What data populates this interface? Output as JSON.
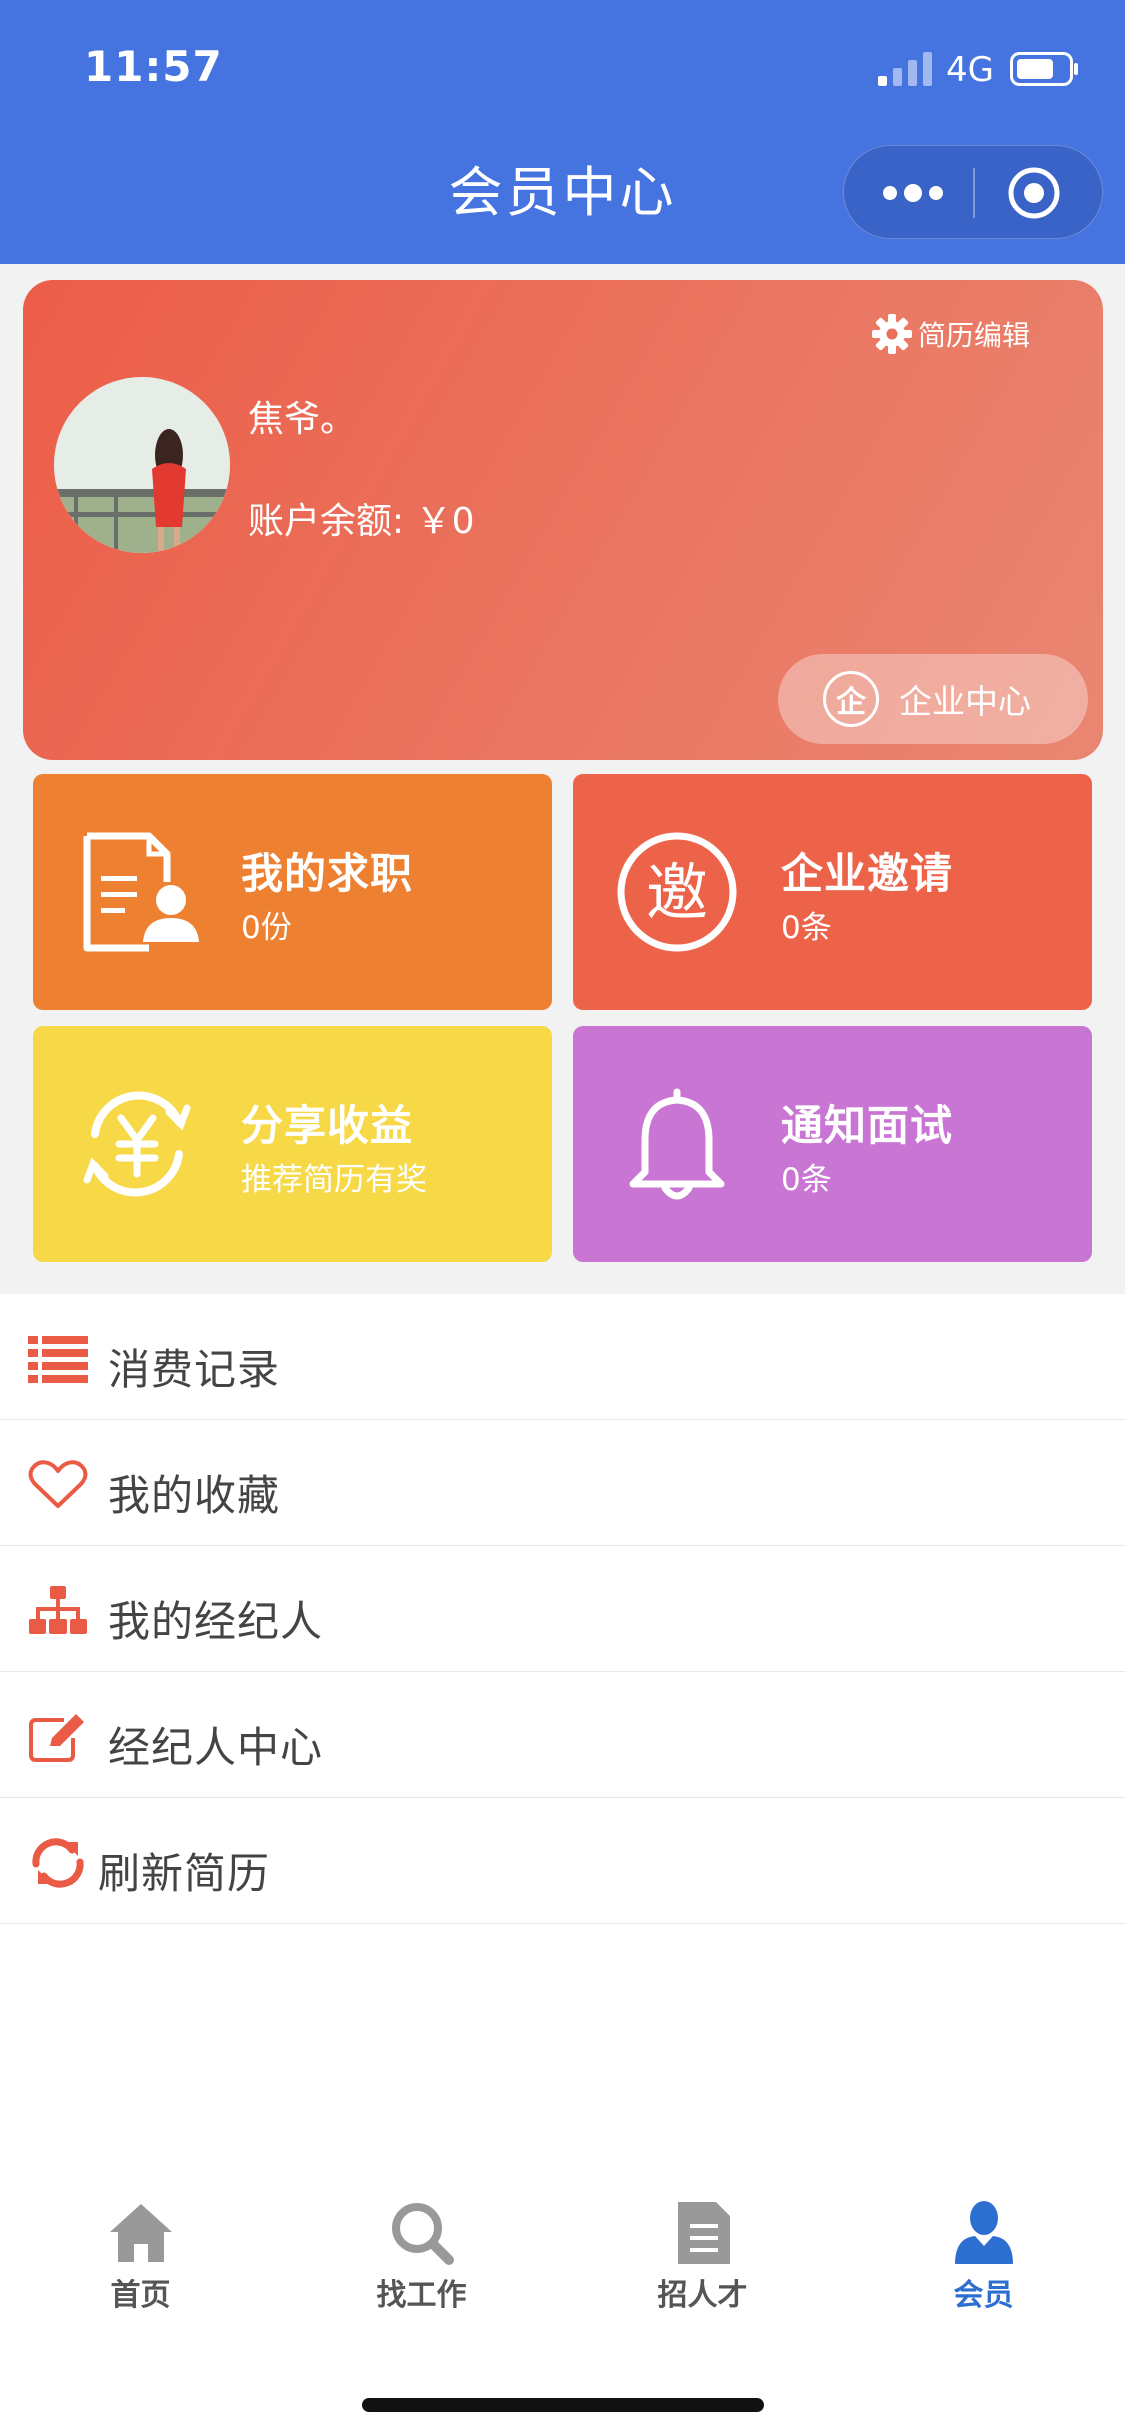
{
  "status_bar": {
    "time": "11:57",
    "network": "4G"
  },
  "nav": {
    "title": "会员中心",
    "capsule_icons": [
      "more-icon",
      "target-icon"
    ]
  },
  "profile": {
    "username": "焦爷。",
    "balance_label": "账户余额: ￥0",
    "resume_edit_label": "简历编辑",
    "enterprise_badge": "企",
    "enterprise_label": "企业中心"
  },
  "tiles": [
    {
      "title": "我的求职",
      "sub": "0份",
      "icon": "resume-person-icon",
      "color": "#ee8131"
    },
    {
      "title": "企业邀请",
      "sub": "0条",
      "icon": "invite-icon",
      "icon_text": "邀",
      "color": "#ed6349"
    },
    {
      "title": "分享收益",
      "sub": "推荐简历有奖",
      "icon": "yen-cycle-icon",
      "color": "#f7d847"
    },
    {
      "title": "通知面试",
      "sub": "0条",
      "icon": "bell-icon",
      "color": "#c975d3"
    }
  ],
  "menu": [
    {
      "label": "消费记录",
      "icon": "list-icon"
    },
    {
      "label": "我的收藏",
      "icon": "heart-icon"
    },
    {
      "label": "我的经纪人",
      "icon": "org-chart-icon"
    },
    {
      "label": "经纪人中心",
      "icon": "edit-icon"
    },
    {
      "label": "刷新简历",
      "icon": "refresh-icon"
    }
  ],
  "tabbar": [
    {
      "label": "首页",
      "icon": "home-icon",
      "active": false
    },
    {
      "label": "找工作",
      "icon": "search-icon",
      "active": false
    },
    {
      "label": "招人才",
      "icon": "document-icon",
      "active": false
    },
    {
      "label": "会员",
      "icon": "user-icon",
      "active": true
    }
  ],
  "colors": {
    "nav_blue": "#4573e0",
    "accent_red": "#ec5d48",
    "active_tab": "#2d6fd0"
  }
}
